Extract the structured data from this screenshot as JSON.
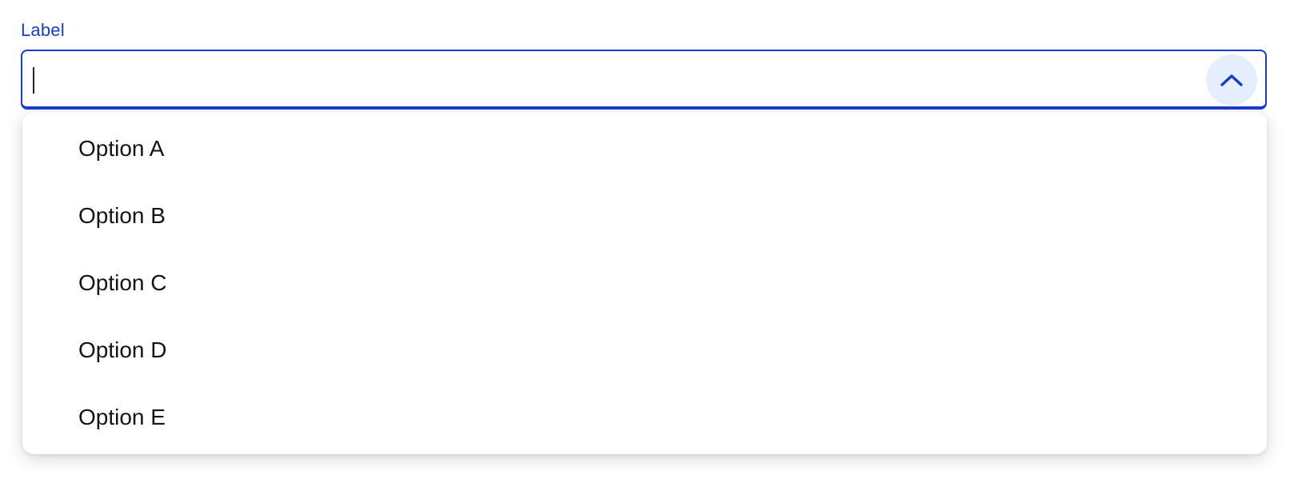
{
  "field": {
    "label": "Label",
    "value": "",
    "placeholder": ""
  },
  "toggle": {
    "icon": "chevron-up-icon",
    "state": "expanded"
  },
  "listbox": {
    "options": [
      {
        "label": "Option A"
      },
      {
        "label": "Option B"
      },
      {
        "label": "Option C"
      },
      {
        "label": "Option D"
      },
      {
        "label": "Option E"
      }
    ]
  },
  "colors": {
    "accent": "#1a3bd1",
    "toggle_background": "#e5eefc",
    "text": "#141414",
    "background": "#ffffff"
  }
}
